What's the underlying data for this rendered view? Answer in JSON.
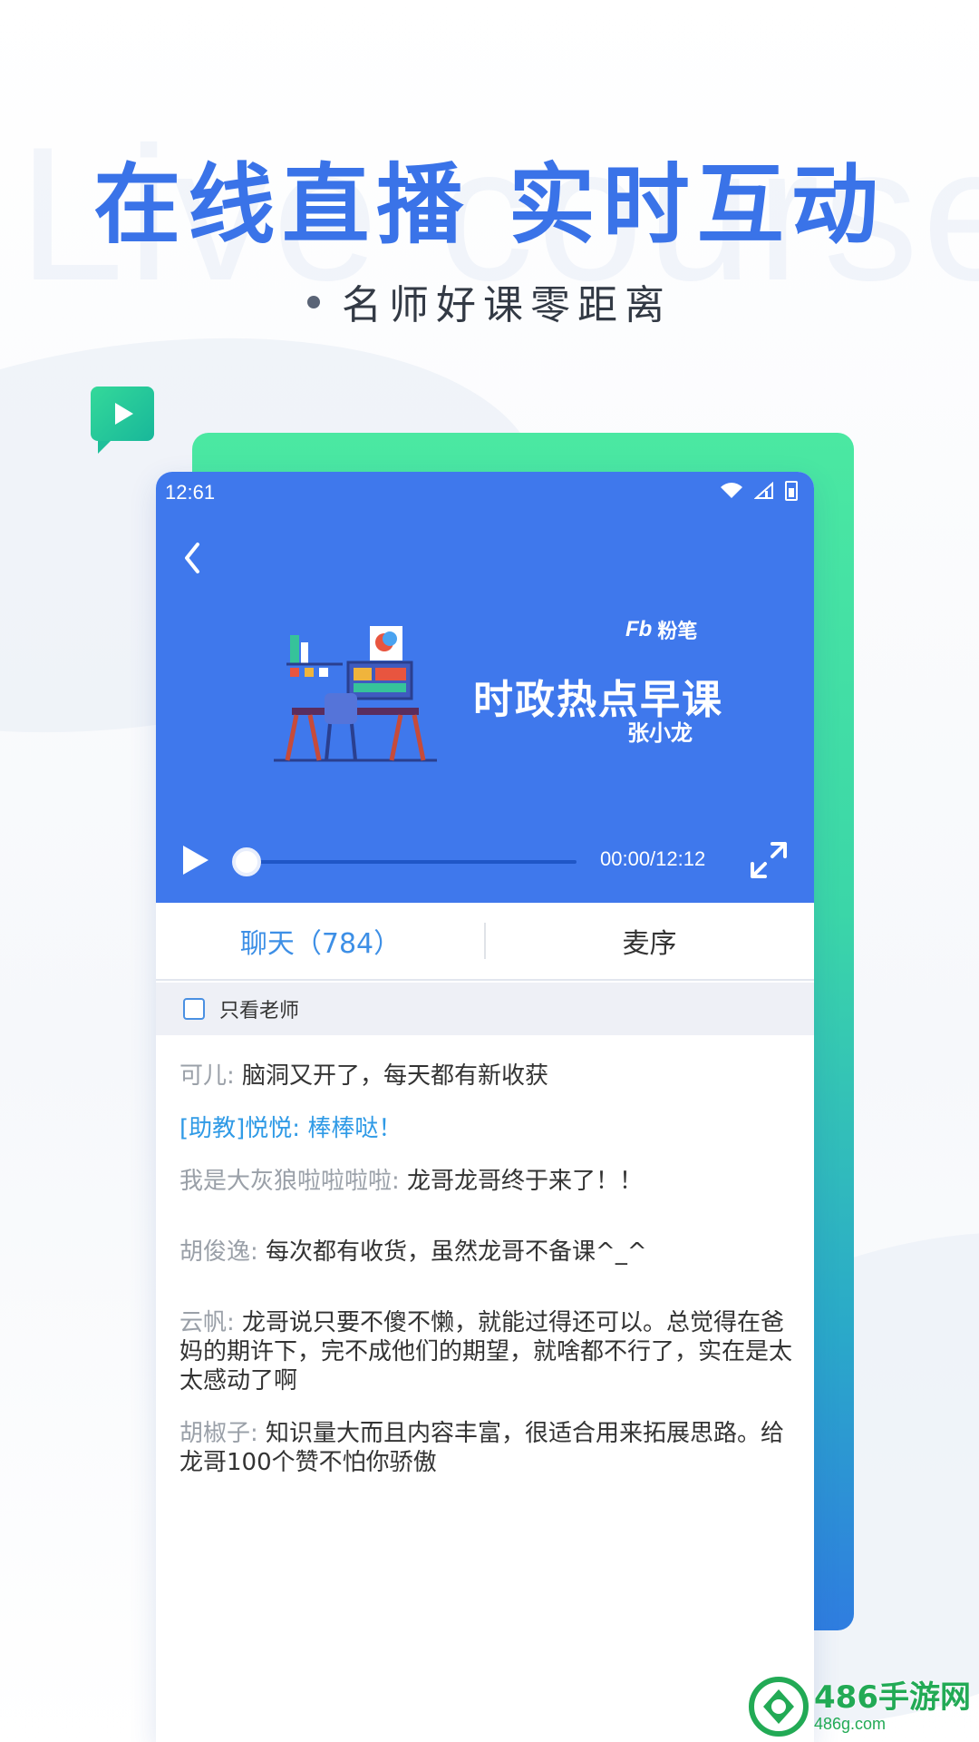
{
  "promo": {
    "watermark": "Live course",
    "headline": "在线直播   实时互动",
    "subline": "名师好课零距离"
  },
  "status_bar": {
    "time": "12:61"
  },
  "video": {
    "brand": "粉笔",
    "brand_logo": "Fb",
    "course_title": "时政热点早课",
    "teacher": "张小龙",
    "time_readout": "00:00/12:12",
    "progress": 0.0
  },
  "tabs": [
    {
      "label": "聊天（784）",
      "active": true
    },
    {
      "label": "麦序",
      "active": false
    }
  ],
  "filter": {
    "label": "只看老师",
    "checked": false
  },
  "chat": [
    {
      "name": "可儿:",
      "text": "脑洞又开了，每天都有新收获",
      "staff": false
    },
    {
      "name": "[助教]悦悦:",
      "text": "棒棒哒！",
      "staff": true
    },
    {
      "name": "我是大灰狼啦啦啦啦:",
      "text": "龙哥龙哥终于来了！！",
      "staff": false
    },
    {
      "name": "胡俊逸:",
      "text": "每次都有收货，虽然龙哥不备课^_^",
      "staff": false
    },
    {
      "name": "云帆:",
      "text": "龙哥说只要不傻不懒，就能过得还可以。总觉得在爸妈的期许下，完不成他们的期望，就啥都不行了，实在是太太感动了啊",
      "staff": false
    },
    {
      "name": "胡椒子:",
      "text": "知识量大而且内容丰富，很适合用来拓展思路。给龙哥100个赞不怕你骄傲",
      "staff": false
    }
  ],
  "site_badge": {
    "name": "486手游网",
    "url": "486g.com"
  },
  "colors": {
    "accent_blue": "#3a73e8",
    "video_bg": "#3f78ec",
    "tab_active": "#3d8fe6",
    "badge_green": "#22aa55"
  }
}
